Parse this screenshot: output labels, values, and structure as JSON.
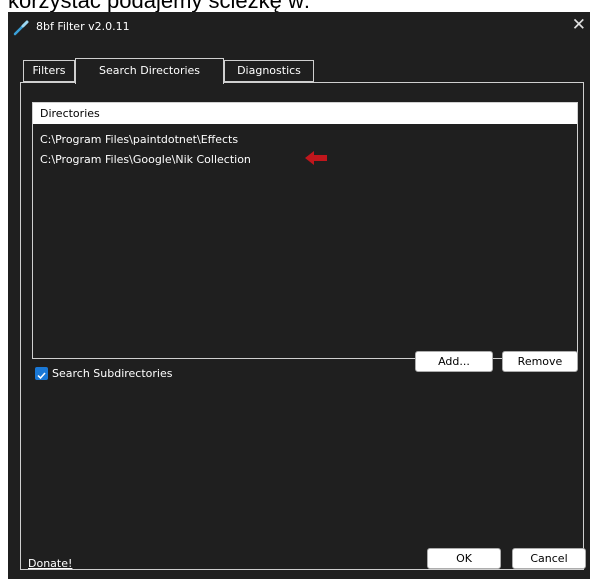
{
  "page_caption": "korzystać podajemy ścieżkę w:",
  "window": {
    "title": "8bf Filter v2.0.11",
    "close_glyph": "✕"
  },
  "tabs": [
    {
      "label": "Filters",
      "active": false
    },
    {
      "label": "Search Directories",
      "active": true
    },
    {
      "label": "Diagnostics",
      "active": false
    }
  ],
  "directories": {
    "header": "Directories",
    "items": [
      "C:\\Program Files\\paintdotnet\\Effects",
      "C:\\Program Files\\Google\\Nik Collection"
    ],
    "highlight_arrow_color": "#c0161c"
  },
  "search_subdirectories": {
    "label": "Search Subdirectories",
    "checked": true,
    "accent": "#1a78d6"
  },
  "buttons": {
    "add": "Add...",
    "remove": "Remove",
    "ok": "OK",
    "cancel": "Cancel"
  },
  "donate_link": "Donate!",
  "colors": {
    "window_bg": "#1f1f1f",
    "text": "#ffffff"
  }
}
